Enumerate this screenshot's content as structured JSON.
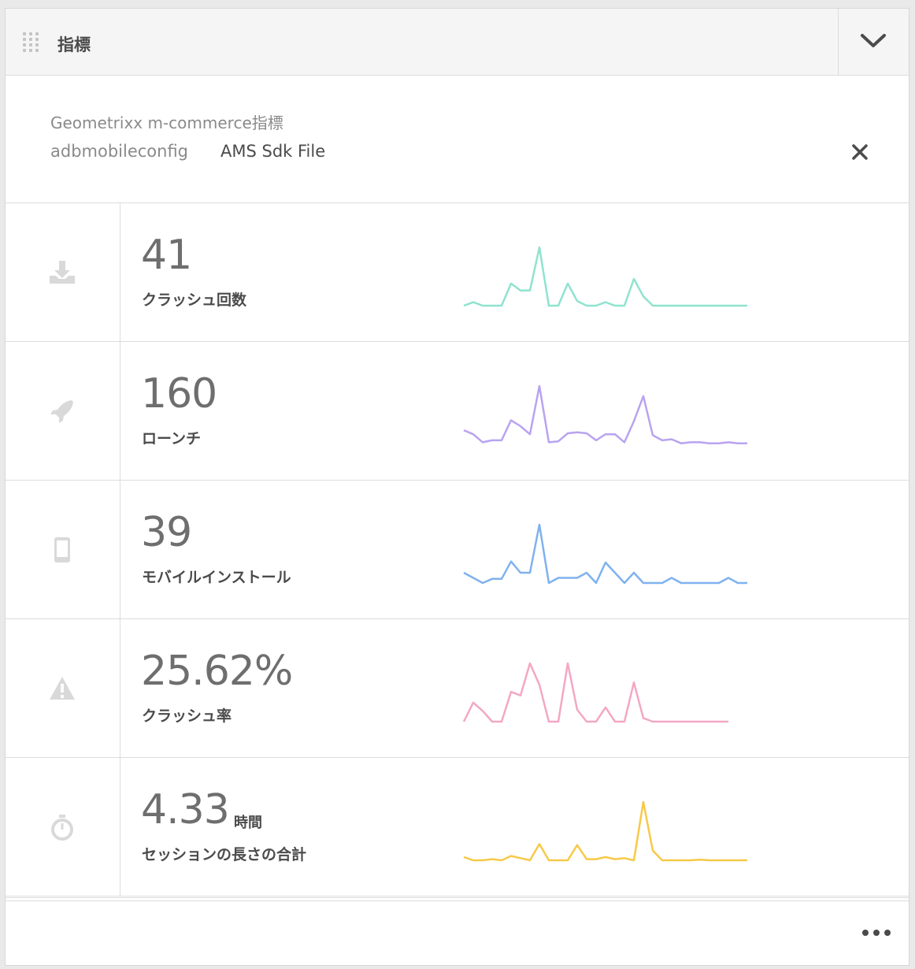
{
  "header": {
    "title": "指標"
  },
  "report": {
    "title": "Geometrixx m-commerce指標",
    "filter_label": "adbmobileconfig",
    "filter_value": "AMS Sdk File"
  },
  "metrics": [
    {
      "value": "41",
      "label": "クラッシュ回数",
      "unit": "",
      "icon": "download-tray-icon",
      "color": "#8fe3cf",
      "series": [
        0,
        0.3,
        0,
        0,
        0,
        1.9,
        1.3,
        1.3,
        5,
        0,
        0,
        1.9,
        0.4,
        0,
        0,
        0.3,
        0,
        0,
        2.3,
        0.8,
        0,
        0,
        0,
        0,
        0,
        0,
        0,
        0,
        0,
        0,
        0
      ]
    },
    {
      "value": "160",
      "label": "ローンチ",
      "unit": "",
      "icon": "rocket-icon",
      "color": "#b9a3f0",
      "series": [
        1.4,
        1,
        0.2,
        0.4,
        0.4,
        2.4,
        1.8,
        1,
        5.8,
        0.2,
        0.3,
        1.1,
        1.2,
        1.1,
        0.4,
        1,
        1,
        0.2,
        2.3,
        4.8,
        0.9,
        0.4,
        0.5,
        0.1,
        0.2,
        0.2,
        0.1,
        0.1,
        0.2,
        0.1,
        0.1
      ]
    },
    {
      "value": "39",
      "label": "モバイルインストール",
      "unit": "",
      "icon": "mobile-phone-icon",
      "color": "#7fb2ef",
      "series": [
        1,
        0.5,
        0,
        0.4,
        0.4,
        2.1,
        1,
        1,
        5.7,
        0,
        0.5,
        0.5,
        0.5,
        1,
        0,
        2,
        1,
        0,
        1,
        0,
        0,
        0,
        0.5,
        0,
        0,
        0,
        0,
        0,
        0.5,
        0,
        0
      ]
    },
    {
      "value": "25.62%",
      "label": "クラッシュ率",
      "unit": "",
      "icon": "warning-triangle-icon",
      "color": "#f4a7c4",
      "series": [
        0,
        1.6,
        0.9,
        0,
        0,
        2.5,
        2.2,
        4.9,
        3.1,
        0,
        0,
        4.9,
        1,
        0,
        0,
        1.2,
        0,
        0,
        3.3,
        0.3,
        0,
        0,
        0,
        0,
        0,
        0,
        0,
        0,
        0
      ]
    },
    {
      "value": "4.33",
      "label": "セッションの長さの合計",
      "unit": "時間",
      "icon": "stopwatch-icon",
      "color": "#f7c948",
      "series": [
        0.3,
        0,
        0,
        0.1,
        0,
        0.4,
        0.2,
        0,
        1.5,
        0,
        0,
        0,
        1.4,
        0.1,
        0.1,
        0.3,
        0.1,
        0.2,
        0,
        5.4,
        0.9,
        0,
        0,
        0,
        0,
        0.05,
        0,
        0,
        0,
        0,
        0
      ]
    }
  ],
  "footer": {
    "more": "more-options-icon"
  }
}
